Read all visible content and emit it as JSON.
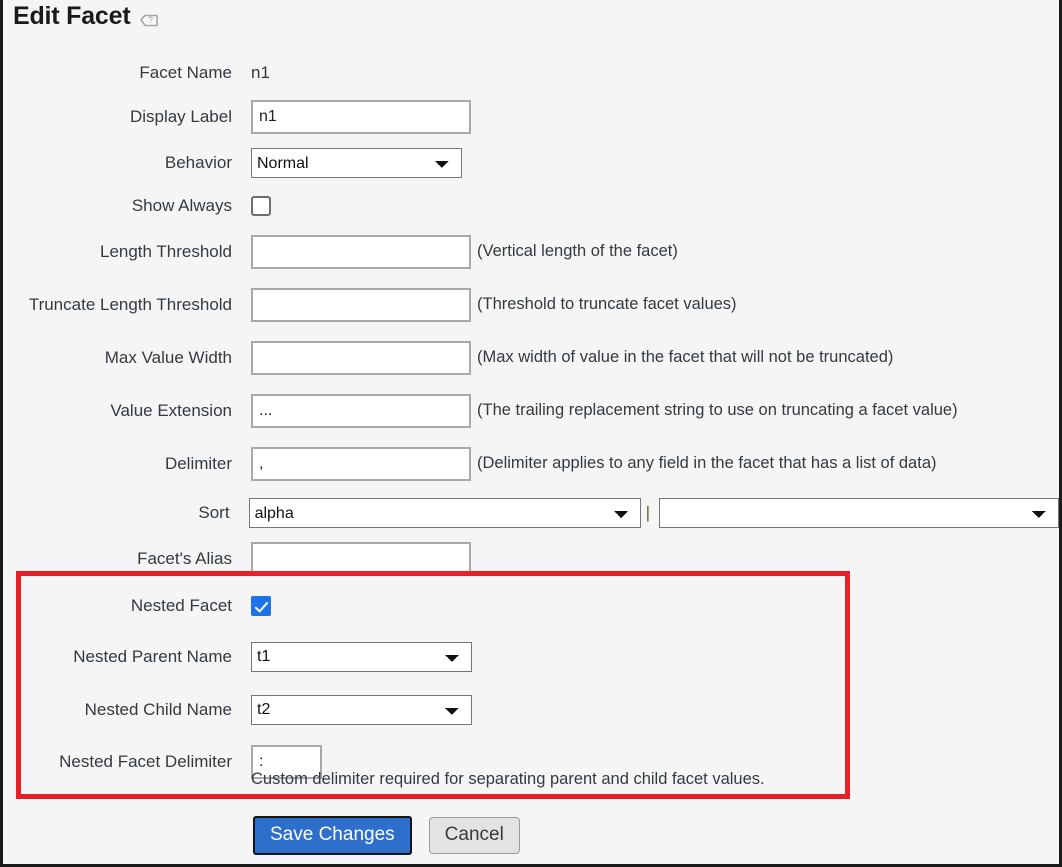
{
  "header": {
    "title": "Edit Facet",
    "help_icon": "help-tag-icon"
  },
  "form": {
    "facet_name": {
      "label": "Facet Name",
      "value": "n1"
    },
    "display_label": {
      "label": "Display Label",
      "value": "n1",
      "placeholder": ""
    },
    "behavior": {
      "label": "Behavior",
      "value": "Normal",
      "options": [
        "Normal"
      ]
    },
    "show_always": {
      "label": "Show Always",
      "checked": false
    },
    "length_threshold": {
      "label": "Length Threshold",
      "value": "",
      "hint": "(Vertical length of the facet)"
    },
    "truncate_length_threshold": {
      "label": "Truncate Length Threshold",
      "value": "",
      "hint": "(Threshold to truncate facet values)"
    },
    "max_value_width": {
      "label": "Max Value Width",
      "value": "",
      "hint": "(Max width of value in the facet that will not be truncated)"
    },
    "value_extension": {
      "label": "Value Extension",
      "value": "...",
      "hint": "(The trailing replacement string to use on truncating a facet value)"
    },
    "delimiter": {
      "label": "Delimiter",
      "value": ",",
      "hint": "(Delimiter applies to any field in the facet that has a list of data)"
    },
    "sort": {
      "label": "Sort",
      "primary_value": "alpha",
      "primary_options": [
        "alpha"
      ],
      "separator": "|",
      "secondary_value": "",
      "secondary_options": [
        ""
      ]
    },
    "facets_alias": {
      "label": "Facet's Alias",
      "value": ""
    }
  },
  "nested_section": {
    "highlight_color": "#e8202a",
    "nested_facet": {
      "label": "Nested Facet",
      "checked": true
    },
    "nested_parent_name": {
      "label": "Nested Parent Name",
      "value": "t1",
      "options": [
        "t1"
      ]
    },
    "nested_child_name": {
      "label": "Nested Child Name",
      "value": "t2",
      "options": [
        "t2"
      ]
    },
    "nested_facet_delimiter": {
      "label": "Nested Facet Delimiter",
      "value": ":"
    },
    "note": "Custom delimiter required for separating parent and child facet values."
  },
  "actions": {
    "save_label": "Save Changes",
    "cancel_label": "Cancel",
    "primary_color": "#2e6fcb"
  }
}
